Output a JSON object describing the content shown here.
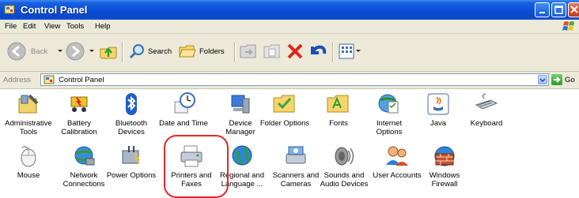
{
  "window": {
    "title": "Control Panel"
  },
  "menu": [
    "File",
    "Edit",
    "View",
    "Tools",
    "Help"
  ],
  "toolbar": {
    "back": "Back",
    "search": "Search",
    "folders": "Folders"
  },
  "address": {
    "label": "Address",
    "value": "Control Panel",
    "go": "Go"
  },
  "items": [
    {
      "label1": "Administrative",
      "label2": "Tools",
      "icon": "administrative-tools-icon"
    },
    {
      "label1": "Battery",
      "label2": "Calibration",
      "icon": "battery-icon"
    },
    {
      "label1": "Bluetooth",
      "label2": "Devices",
      "icon": "bluetooth-icon"
    },
    {
      "label1": "Date and Time",
      "label2": "",
      "icon": "clock-icon"
    },
    {
      "label1": "Device",
      "label2": "Manager",
      "icon": "device-manager-icon"
    },
    {
      "label1": "Folder Options",
      "label2": "",
      "icon": "folder-options-icon"
    },
    {
      "label1": "Fonts",
      "label2": "",
      "icon": "fonts-folder-icon"
    },
    {
      "label1": "Internet",
      "label2": "Options",
      "icon": "internet-options-icon"
    },
    {
      "label1": "Java",
      "label2": "",
      "icon": "java-icon"
    },
    {
      "label1": "Keyboard",
      "label2": "",
      "icon": "keyboard-icon"
    },
    {
      "label1": "Mouse",
      "label2": "",
      "icon": "mouse-icon"
    },
    {
      "label1": "Network",
      "label2": "Connections",
      "icon": "network-icon"
    },
    {
      "label1": "Power Options",
      "label2": "",
      "icon": "power-options-icon"
    },
    {
      "label1": "Printers and",
      "label2": "Faxes",
      "icon": "printer-icon"
    },
    {
      "label1": "Regional and",
      "label2": "Language ...",
      "icon": "globe-icon"
    },
    {
      "label1": "Scanners and",
      "label2": "Cameras",
      "icon": "scanner-icon"
    },
    {
      "label1": "Sounds and",
      "label2": "Audio Devices",
      "icon": "speaker-icon"
    },
    {
      "label1": "User Accounts",
      "label2": "",
      "icon": "users-icon"
    },
    {
      "label1": "Windows",
      "label2": "Firewall",
      "icon": "firewall-icon"
    }
  ]
}
